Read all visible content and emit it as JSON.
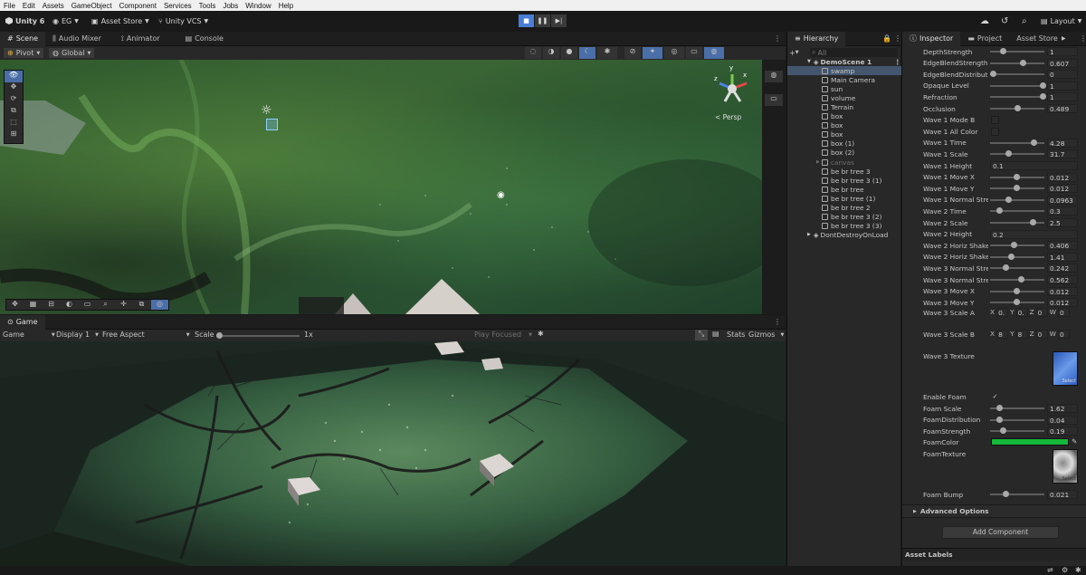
{
  "menu": [
    "File",
    "Edit",
    "Assets",
    "GameObject",
    "Component",
    "Services",
    "Tools",
    "Jobs",
    "Window",
    "Help"
  ],
  "toolbar": {
    "unity_version": "Unity 6",
    "account": "EG",
    "asset_store": "Asset Store",
    "vcs": "Unity VCS",
    "layout": "Layout"
  },
  "scene_tabs": [
    "Scene",
    "Audio Mixer",
    "Animator",
    "Console"
  ],
  "scene_toolbar": {
    "pivot": "Pivot",
    "global": "Global",
    "persp": "< Persp"
  },
  "gizmo_axes": {
    "x": "x",
    "y": "y",
    "z": "z"
  },
  "game_tabs": [
    "Game"
  ],
  "game_toolbar": {
    "mode": "Game",
    "display": "Display 1",
    "aspect": "Free Aspect",
    "scale_label": "Scale",
    "scale_value": "1x",
    "play_focused": "Play Focused",
    "stats": "Stats",
    "gizmos": "Gizmos"
  },
  "hierarchy": {
    "title": "Hierarchy",
    "search_placeholder": "All",
    "scene_name": "DemoScene 1",
    "items": [
      "swamp",
      "Main Camera",
      "sun",
      "volume",
      "Terrain",
      "box",
      "box",
      "box",
      "box (1)",
      "box (2)",
      "canvas",
      "be br tree 3",
      "be br tree 3 (1)",
      "be br tree",
      "be br tree (1)",
      "be br tree 2",
      "be br tree 3 (2)",
      "be br tree 3 (3)"
    ],
    "dontdestroy": "DontDestroyOnLoad"
  },
  "inspector": {
    "tabs": [
      "Inspector",
      "Project",
      "Asset Store"
    ],
    "props": [
      {
        "label": "DepthStrength",
        "value": "1",
        "pos": 0.2
      },
      {
        "label": "EdgeBlendStrength",
        "value": "0.607",
        "pos": 0.6
      },
      {
        "label": "EdgeBlendDistribution",
        "value": "0",
        "pos": 0.0
      },
      {
        "label": "Opaque Level",
        "value": "1",
        "pos": 1.0
      },
      {
        "label": "Refraction",
        "value": "1",
        "pos": 1.0
      },
      {
        "label": "Occlusion",
        "value": "0.489",
        "pos": 0.49
      },
      {
        "label": "Wave 1 Mode B",
        "check": ""
      },
      {
        "label": "Wave 1 All Color",
        "check": ""
      },
      {
        "label": "Wave 1 Time",
        "value": "4.28",
        "pos": 0.82
      },
      {
        "label": "Wave 1 Scale",
        "value": "31.7",
        "pos": 0.3
      },
      {
        "label": "Wave 1 Height",
        "wide": "0.1"
      },
      {
        "label": "Wave 1 Move X",
        "value": "0.012",
        "pos": 0.48
      },
      {
        "label": "Wave 1 Move Y",
        "value": "0.012",
        "pos": 0.48
      },
      {
        "label": "Wave 1 Normal Strength",
        "value": "0.0963",
        "pos": 0.3
      },
      {
        "label": "Wave 2 Time",
        "value": "0.3",
        "pos": 0.12
      },
      {
        "label": "Wave 2 Scale",
        "value": "2.5",
        "pos": 0.8
      },
      {
        "label": "Wave 2 Height",
        "wide": "0.2"
      },
      {
        "label": "Wave 2 Horiz Shake",
        "value": "0.406",
        "pos": 0.42
      },
      {
        "label": "Wave 2 Horiz Shake",
        "value": "1.41",
        "pos": 0.36
      },
      {
        "label": "Wave 3 Normal Strength",
        "value": "0.242",
        "pos": 0.25
      },
      {
        "label": "Wave 3 Normal Strength",
        "value": "0.562",
        "pos": 0.57
      },
      {
        "label": "Wave 3 Move X",
        "value": "0.012",
        "pos": 0.48
      },
      {
        "label": "Wave 3 Move Y",
        "value": "0.012",
        "pos": 0.48
      }
    ],
    "scale_a": {
      "label": "Wave 3 Scale A",
      "x": "0.",
      "y": "0.",
      "z": "0",
      "w": "0"
    },
    "scale_b": {
      "label": "Wave 3 Scale B",
      "x": "8",
      "y": "8",
      "z": "0",
      "w": "0"
    },
    "texture_label": "Wave 3 Texture",
    "select_label": "Select",
    "enable_foam": "Enable Foam",
    "enable_foam_check": "✓",
    "foam_props": [
      {
        "label": "Foam Scale",
        "value": "1.62",
        "pos": 0.12
      },
      {
        "label": "FoamDistribution",
        "value": "0.04",
        "pos": 0.12
      },
      {
        "label": "FoamStrength",
        "value": "0.19",
        "pos": 0.2
      }
    ],
    "foam_color_label": "FoamColor",
    "foam_color": "#16b83a",
    "foam_texture_label": "FoamTexture",
    "foam_bump": {
      "label": "Foam Bump",
      "value": "0.021",
      "pos": 0.25
    },
    "advanced": "Advanced Options",
    "add_component": "Add Component",
    "asset_labels": "Asset Labels"
  }
}
